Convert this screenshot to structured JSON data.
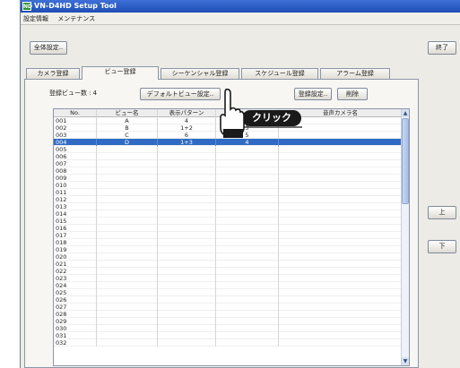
{
  "window": {
    "title": "VN-D4HD Setup Tool",
    "icon_text": "ND"
  },
  "menu": [
    "設定情報",
    "メンテナンス"
  ],
  "buttons": {
    "global_settings": "全体設定..",
    "exit": "終了",
    "up": "上",
    "down": "下"
  },
  "tabs": [
    {
      "label": "カメラ登録",
      "active": false
    },
    {
      "label": "ビュー登録",
      "active": true
    },
    {
      "label": "シーケンシャル登録",
      "active": false
    },
    {
      "label": "スケジュール登録",
      "active": false
    },
    {
      "label": "アラーム登録",
      "active": false
    }
  ],
  "view_panel": {
    "count_label": "登録ビュー数 :",
    "count_value": "4",
    "default_view_button": "デフォルトビュー設定..",
    "register_settings_button": "登録設定..",
    "delete_button": "削除"
  },
  "table": {
    "columns": [
      "No.",
      "ビュー名",
      "表示パターン",
      "",
      "音声カメラ名"
    ],
    "rows": [
      {
        "no": "001",
        "name": "A",
        "pattern": "4",
        "extra": "",
        "audio": ""
      },
      {
        "no": "002",
        "name": "B",
        "pattern": "1+2",
        "extra": "3",
        "audio": ""
      },
      {
        "no": "003",
        "name": "C",
        "pattern": "6",
        "extra": "5",
        "audio": ""
      },
      {
        "no": "004",
        "name": "D",
        "pattern": "1+3",
        "extra": "4",
        "audio": ""
      },
      {
        "no": "005",
        "name": "",
        "pattern": "",
        "extra": "",
        "audio": ""
      },
      {
        "no": "006",
        "name": "",
        "pattern": "",
        "extra": "",
        "audio": ""
      },
      {
        "no": "007",
        "name": "",
        "pattern": "",
        "extra": "",
        "audio": ""
      },
      {
        "no": "008",
        "name": "",
        "pattern": "",
        "extra": "",
        "audio": ""
      },
      {
        "no": "009",
        "name": "",
        "pattern": "",
        "extra": "",
        "audio": ""
      },
      {
        "no": "010",
        "name": "",
        "pattern": "",
        "extra": "",
        "audio": ""
      },
      {
        "no": "011",
        "name": "",
        "pattern": "",
        "extra": "",
        "audio": ""
      },
      {
        "no": "012",
        "name": "",
        "pattern": "",
        "extra": "",
        "audio": ""
      },
      {
        "no": "013",
        "name": "",
        "pattern": "",
        "extra": "",
        "audio": ""
      },
      {
        "no": "014",
        "name": "",
        "pattern": "",
        "extra": "",
        "audio": ""
      },
      {
        "no": "015",
        "name": "",
        "pattern": "",
        "extra": "",
        "audio": ""
      },
      {
        "no": "016",
        "name": "",
        "pattern": "",
        "extra": "",
        "audio": ""
      },
      {
        "no": "017",
        "name": "",
        "pattern": "",
        "extra": "",
        "audio": ""
      },
      {
        "no": "018",
        "name": "",
        "pattern": "",
        "extra": "",
        "audio": ""
      },
      {
        "no": "019",
        "name": "",
        "pattern": "",
        "extra": "",
        "audio": ""
      },
      {
        "no": "020",
        "name": "",
        "pattern": "",
        "extra": "",
        "audio": ""
      },
      {
        "no": "021",
        "name": "",
        "pattern": "",
        "extra": "",
        "audio": ""
      },
      {
        "no": "022",
        "name": "",
        "pattern": "",
        "extra": "",
        "audio": ""
      },
      {
        "no": "023",
        "name": "",
        "pattern": "",
        "extra": "",
        "audio": ""
      },
      {
        "no": "024",
        "name": "",
        "pattern": "",
        "extra": "",
        "audio": ""
      },
      {
        "no": "025",
        "name": "",
        "pattern": "",
        "extra": "",
        "audio": ""
      },
      {
        "no": "026",
        "name": "",
        "pattern": "",
        "extra": "",
        "audio": ""
      },
      {
        "no": "027",
        "name": "",
        "pattern": "",
        "extra": "",
        "audio": ""
      },
      {
        "no": "028",
        "name": "",
        "pattern": "",
        "extra": "",
        "audio": ""
      },
      {
        "no": "029",
        "name": "",
        "pattern": "",
        "extra": "",
        "audio": ""
      },
      {
        "no": "030",
        "name": "",
        "pattern": "",
        "extra": "",
        "audio": ""
      },
      {
        "no": "031",
        "name": "",
        "pattern": "",
        "extra": "",
        "audio": ""
      },
      {
        "no": "032",
        "name": "",
        "pattern": "",
        "extra": "",
        "audio": ""
      }
    ],
    "selected_row": "004"
  },
  "callout": {
    "text": "クリック"
  },
  "colors": {
    "title_bar": "#1f4fb5",
    "selection": "#2f6bc4",
    "callout_bg": "#1a1a1a"
  }
}
